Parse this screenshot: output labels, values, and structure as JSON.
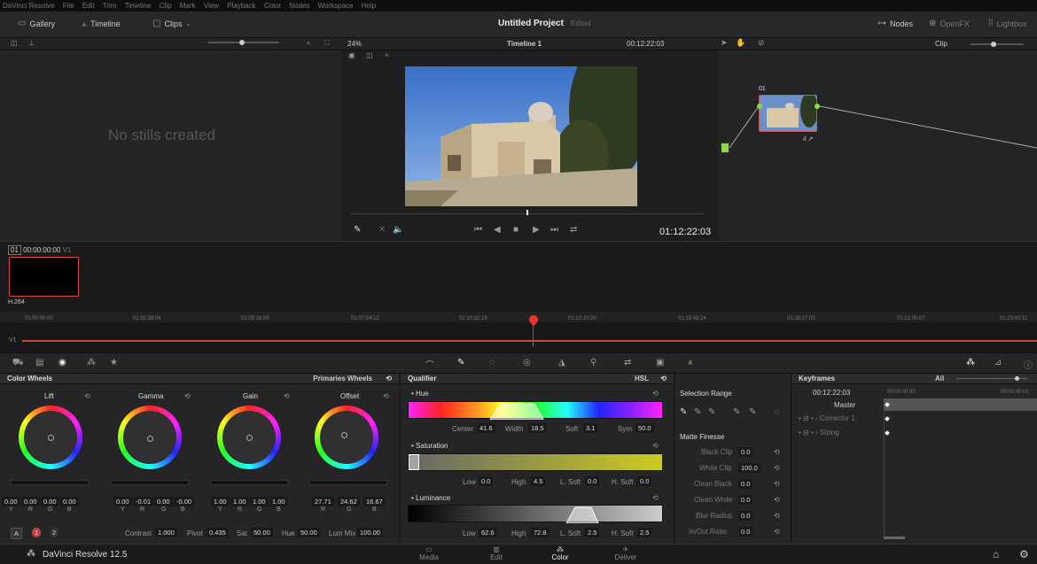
{
  "menubar": {
    "items": [
      "DaVinci Resolve",
      "File",
      "Edit",
      "Trim",
      "Timeline",
      "Clip",
      "Mark",
      "View",
      "Playback",
      "Color",
      "Nodes",
      "Workspace",
      "Help"
    ]
  },
  "toolbar": {
    "gallery": "Gallery",
    "timeline": "Timeline",
    "clips": "Clips",
    "project_title": "Untitled Project",
    "edited": "Edited",
    "nodes": "Nodes",
    "openfx": "OpenFX",
    "lightbox": "Lightbox"
  },
  "viewer": {
    "zoom": "24%",
    "timeline_name": "Timeline 1",
    "timecode": "00:12:22:03",
    "timecode_big": "01:12:22:03"
  },
  "gallery": {
    "empty": "No stills created"
  },
  "nodes": {
    "mode": "Clip",
    "node_label": "01"
  },
  "clip": {
    "index": "01",
    "timecode": "00:00:00:00",
    "track": "V1",
    "codec": "H.264"
  },
  "timeline": {
    "ticks": [
      "01:00:00:00",
      "01:02:38:04",
      "01:05:16:08",
      "01:07:54:12",
      "01:10:32:16",
      "01:13:10:20",
      "01:15:48:24",
      "01:18:27:03",
      "01:21:05:07",
      "01:23:43:11"
    ],
    "track": "V1"
  },
  "wheels": {
    "title": "Color Wheels",
    "mode": "Primaries Wheels",
    "items": [
      {
        "name": "Lift",
        "values": [
          "0.00",
          "0.00",
          "0.00",
          "0.00"
        ],
        "channels": [
          "Y",
          "R",
          "G",
          "B"
        ]
      },
      {
        "name": "Gamma",
        "values": [
          "0.00",
          "-0.01",
          "0.00",
          "-0.00"
        ],
        "channels": [
          "Y",
          "R",
          "G",
          "B"
        ]
      },
      {
        "name": "Gain",
        "values": [
          "1.00",
          "1.00",
          "1.00",
          "1.00"
        ],
        "channels": [
          "Y",
          "R",
          "G",
          "B"
        ]
      },
      {
        "name": "Offset",
        "values": [
          "27.71",
          "24.62",
          "16.67"
        ],
        "channels": [
          "R",
          "G",
          "B"
        ]
      }
    ],
    "footer": {
      "a": "A",
      "p1": "1",
      "p2": "2",
      "contrast_lbl": "Contrast",
      "contrast": "1.000",
      "pivot_lbl": "Pivot",
      "pivot": "0.435",
      "sat_lbl": "Sat",
      "sat": "50.00",
      "hue_lbl": "Hue",
      "hue": "50.00",
      "lummix_lbl": "Lum Mix",
      "lummix": "100.00"
    }
  },
  "qualifier": {
    "title": "Qualifier",
    "mode": "HSL",
    "hue": {
      "label": "Hue",
      "center_lbl": "Center",
      "center": "41.6",
      "width_lbl": "Width",
      "width": "18.5",
      "soft_lbl": "Soft",
      "soft": "3.1",
      "sym_lbl": "Sym",
      "sym": "50.0"
    },
    "sat": {
      "label": "Saturation",
      "low_lbl": "Low",
      "low": "0.0",
      "high_lbl": "High",
      "high": "4.5",
      "lsoft_lbl": "L. Soft",
      "lsoft": "0.0",
      "hsoft_lbl": "H. Soft",
      "hsoft": "0.0"
    },
    "lum": {
      "label": "Luminance",
      "low_lbl": "Low",
      "low": "62.6",
      "high_lbl": "High",
      "high": "72.8",
      "lsoft_lbl": "L. Soft",
      "lsoft": "2.5",
      "hsoft_lbl": "H. Soft",
      "hsoft": "2.5"
    }
  },
  "selection": {
    "title": "Selection Range",
    "matte": "Matte Finesse",
    "rows": [
      {
        "label": "Black Clip",
        "value": "0.0"
      },
      {
        "label": "White Clip",
        "value": "100.0"
      },
      {
        "label": "Clean Black",
        "value": "0.0"
      },
      {
        "label": "Clean White",
        "value": "0.0"
      },
      {
        "label": "Blur Radius",
        "value": "0.0"
      },
      {
        "label": "In/Out Ratio",
        "value": "0.0"
      }
    ]
  },
  "keyframes": {
    "title": "Keyframes",
    "filter": "All",
    "tc": "00:12:22:03",
    "tc2": "00:00:00:00",
    "tc3": "00:00:00:01",
    "master": "Master",
    "corrector": "Corrector 1",
    "sizing": "Sizing"
  },
  "bottom": {
    "app": "DaVinci Resolve 12.5",
    "nav": [
      "Media",
      "Edit",
      "Color",
      "Deliver"
    ]
  }
}
